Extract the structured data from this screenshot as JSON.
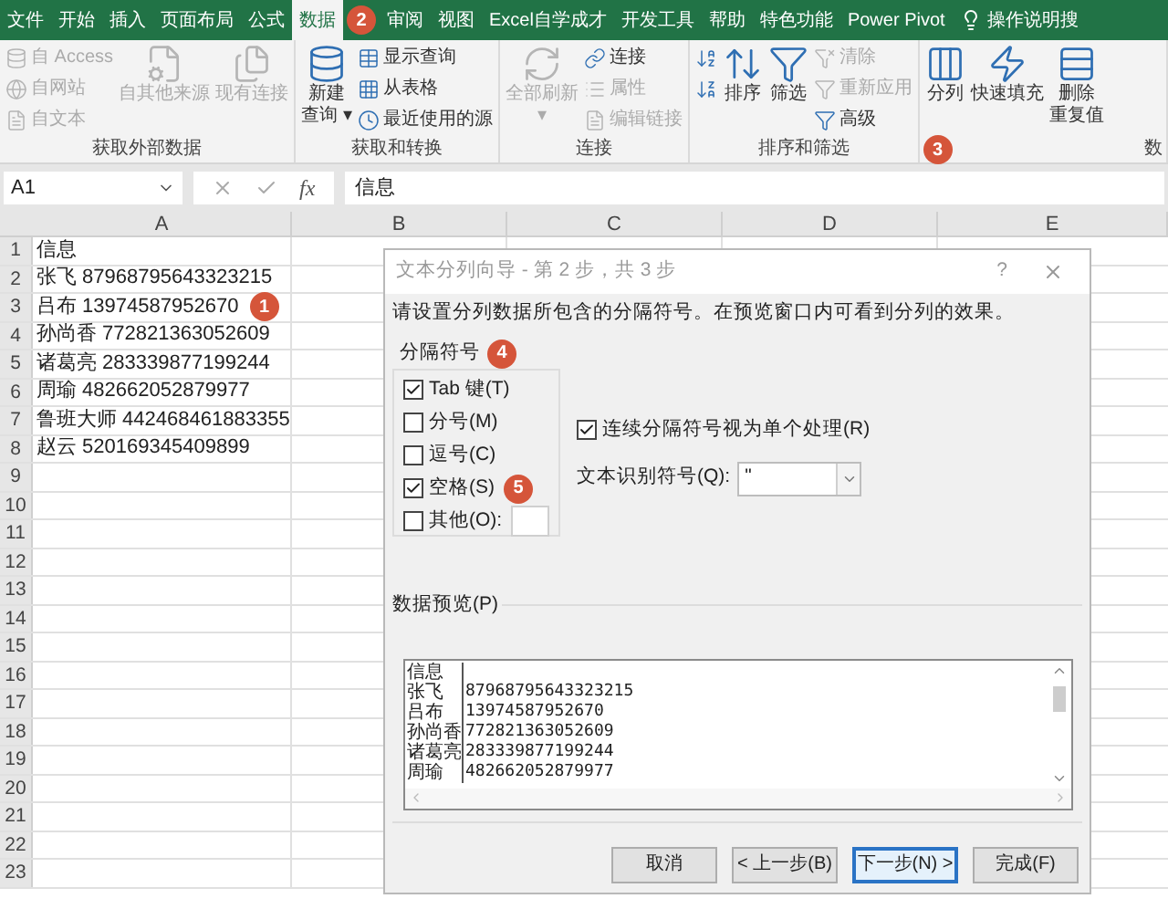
{
  "ribbon_tabs": [
    {
      "label": "文件",
      "selected": false
    },
    {
      "label": "开始",
      "selected": false
    },
    {
      "label": "插入",
      "selected": false
    },
    {
      "label": "页面布局",
      "selected": false
    },
    {
      "label": "公式",
      "selected": false
    },
    {
      "label": "数据",
      "selected": true
    },
    {
      "label": "审阅",
      "selected": false
    },
    {
      "label": "视图",
      "selected": false
    },
    {
      "label": "Excel自学成才",
      "selected": false
    },
    {
      "label": "开发工具",
      "selected": false
    },
    {
      "label": "帮助",
      "selected": false
    },
    {
      "label": "特色功能",
      "selected": false
    },
    {
      "label": "Power Pivot",
      "selected": false
    }
  ],
  "tell_me": "操作说明搜",
  "ribbon_groups": [
    {
      "label": "获取外部数据",
      "items": [
        {
          "kind": "small_stack",
          "entries": [
            {
              "label": "自 Access",
              "disabled": true
            },
            {
              "label": "自网站",
              "disabled": true
            },
            {
              "label": "自文本",
              "disabled": true
            }
          ]
        },
        {
          "kind": "large",
          "lines": [
            "自其他来源"
          ],
          "disabled": true
        },
        {
          "kind": "large",
          "lines": [
            "现有连接"
          ],
          "disabled": true
        }
      ]
    },
    {
      "label": "获取和转换",
      "items": [
        {
          "kind": "large",
          "lines": [
            "新建",
            "查询 ▾"
          ],
          "disabled": false
        },
        {
          "kind": "small_stack",
          "entries": [
            {
              "label": "显示查询",
              "disabled": false
            },
            {
              "label": "从表格",
              "disabled": false
            },
            {
              "label": "最近使用的源",
              "disabled": false
            }
          ]
        }
      ]
    },
    {
      "label": "连接",
      "items": [
        {
          "kind": "large",
          "lines": [
            "全部刷新",
            "▾"
          ],
          "disabled": true
        },
        {
          "kind": "small_stack",
          "entries": [
            {
              "label": "连接",
              "disabled": false
            },
            {
              "label": "属性",
              "disabled": true
            },
            {
              "label": "编辑链接",
              "disabled": true
            }
          ]
        }
      ]
    },
    {
      "label": "排序和筛选",
      "items": [
        {
          "kind": "small_stack",
          "entries": [
            {
              "disabled": false
            },
            {
              "disabled": false
            }
          ]
        },
        {
          "kind": "large",
          "lines": [
            "排序"
          ],
          "disabled": false
        },
        {
          "kind": "large",
          "lines": [
            "筛选"
          ],
          "disabled": false
        },
        {
          "kind": "small_stack",
          "entries": [
            {
              "label": "清除",
              "disabled": true
            },
            {
              "label": "重新应用",
              "disabled": true
            },
            {
              "label": "高级",
              "disabled": false
            }
          ]
        }
      ]
    },
    {
      "label": "数",
      "items": [
        {
          "kind": "large",
          "lines": [
            "分列"
          ],
          "disabled": false
        },
        {
          "kind": "large",
          "lines": [
            "快速填充"
          ],
          "disabled": false
        },
        {
          "kind": "large",
          "lines": [
            "删除",
            "重复值"
          ],
          "disabled": false
        }
      ]
    }
  ],
  "name_box": "A1",
  "formula_fx": "fx",
  "formula": "信息",
  "columns": [
    "A",
    "B",
    "C",
    "D",
    "E"
  ],
  "row_numbers": [
    "1",
    "2",
    "3",
    "4",
    "5",
    "6",
    "7",
    "8",
    "9",
    "10",
    "11",
    "12",
    "13",
    "14",
    "15",
    "16",
    "17",
    "18",
    "19",
    "20",
    "21",
    "22",
    "23"
  ],
  "column_a": [
    "信息",
    "张飞 87968795643323215",
    "吕布 13974587952670",
    "孙尚香 772821363052609",
    "诸葛亮 283339877199244",
    "周瑜 482662052879977",
    "鲁班大师 442468461883355",
    "赵云 520169345409899"
  ],
  "dialog": {
    "title": "文本分列向导 - 第 2 步，共 3 步",
    "help": "?",
    "instruction": "请设置分列数据所包含的分隔符号。在预览窗口内可看到分列的效果。",
    "delimiters_label": "分隔符号",
    "delimiters": [
      {
        "label": "Tab 键(T)",
        "checked": true
      },
      {
        "label": "分号(M)",
        "checked": false
      },
      {
        "label": "逗号(C)",
        "checked": false
      },
      {
        "label": "空格(S)",
        "checked": true
      },
      {
        "label": "其他(O):",
        "checked": false,
        "kind": "other"
      }
    ],
    "consecutive": {
      "label": "连续分隔符号视为单个处理(R)",
      "checked": true
    },
    "qualifier_label": "文本识别符号(Q):",
    "qualifier_value": "\"",
    "preview_label": "数据预览(P)",
    "preview_rows": [
      [
        "信息",
        ""
      ],
      [
        "张飞",
        "87968795643323215"
      ],
      [
        "吕布",
        "13974587952670"
      ],
      [
        "孙尚香",
        "772821363052609"
      ],
      [
        "诸葛亮",
        "283339877199244"
      ],
      [
        "周瑜",
        "482662052879977"
      ]
    ],
    "buttons": [
      {
        "label": "取消",
        "default": false
      },
      {
        "label": "< 上一步(B)",
        "default": false
      },
      {
        "label": "下一步(N) >",
        "default": true
      },
      {
        "label": "完成(F)",
        "default": false
      }
    ]
  },
  "annotations": [
    "1",
    "2",
    "3",
    "4",
    "5"
  ]
}
